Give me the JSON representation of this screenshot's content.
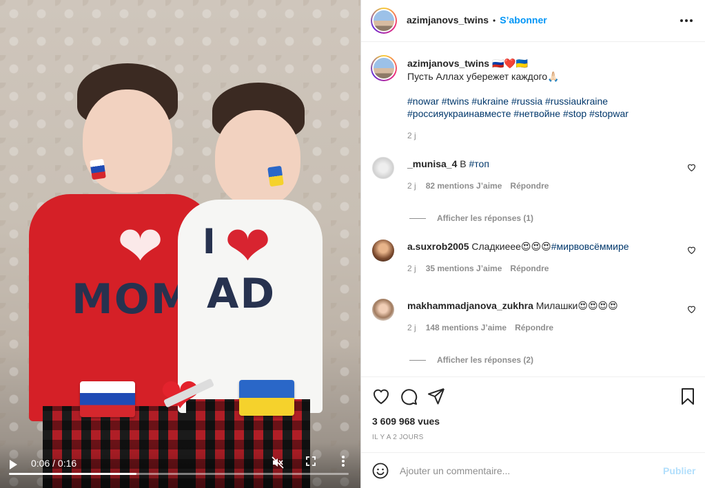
{
  "post": {
    "username": "azimjanovs_twins",
    "follow_label": "S’abonner",
    "more_options_icon": "more-horizontal-icon"
  },
  "caption": {
    "username": "azimjanovs_twins",
    "emoji": "🇷🇺❤️🇺🇦",
    "line1": "Пусть Аллах убережет каждого🙏🏻",
    "hashtags_line1": "#nowar #twins #ukraine #russia #russiaukraine",
    "hashtags_line2": "#россияукраинавместе #нетвойне #stop #stopwar",
    "time": "2 j"
  },
  "comments": [
    {
      "username": "_munisa_4",
      "text": "В ",
      "tag": "#топ",
      "time": "2 j",
      "likes": "82 mentions J’aime",
      "reply": "Répondre",
      "view_replies": "Afficher les réponses (1)"
    },
    {
      "username": "a.suxrob2005",
      "text": "Сладкиеее😍😍😍",
      "tag": "#мирвовсёммире",
      "time": "2 j",
      "likes": "35 mentions J’aime",
      "reply": "Répondre"
    },
    {
      "username": "makhammadjanova_zukhra",
      "text": "Милашки😍😍😍😍",
      "tag": "",
      "time": "2 j",
      "likes": "148 mentions J’aime",
      "reply": "Répondre",
      "view_replies": "Afficher les réponses (2)"
    }
  ],
  "stats": {
    "views": "3 609 968 vues",
    "ago": "IL Y A 2 JOURS"
  },
  "add_comment": {
    "placeholder": "Ajouter un commentaire...",
    "publish": "Publier"
  },
  "video": {
    "time_label": "0:06 / 0:16",
    "progress": 0.375,
    "shirt_left": "MOM",
    "shirt_right_top": "I",
    "shirt_right": "AD"
  },
  "colors": {
    "accent": "#0095f6",
    "publish_disabled": "#b2dffc",
    "hashtag": "#00376b",
    "meta": "#8e8e8e"
  }
}
